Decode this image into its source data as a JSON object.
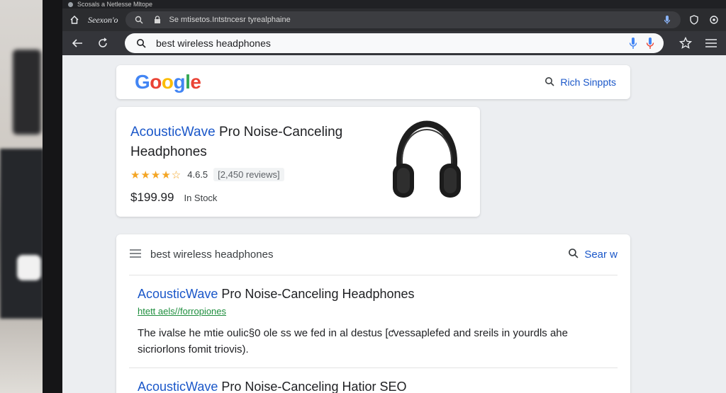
{
  "titlebar": {
    "text": "Scosals a Netlesse Mltope"
  },
  "tabbar": {
    "tab_title": "Seexon'o",
    "url": "Se mtisetos.Intstncesr tyrealphaine"
  },
  "toolbar": {
    "search_query": "best wireless headphones"
  },
  "google": {
    "logo_letters": [
      "G",
      "o",
      "o",
      "g",
      "l",
      "e"
    ],
    "logo_colors": [
      "#4285f4",
      "#ea4335",
      "#fbbc05",
      "#4285f4",
      "#34a853",
      "#ea4335"
    ],
    "rich_snippets_label": "Rich Sinppts"
  },
  "product": {
    "brand": "AcousticWave",
    "title_rest": " Pro Noise-Canceling Headphones",
    "stars": "★★★★☆",
    "rating": "4.6.5",
    "reviews": "[2,450 reviews]",
    "price": "$199.99",
    "stock": "In Stock"
  },
  "results": {
    "header_label": "best wireless headphones",
    "search_label": "Sear w",
    "items": [
      {
        "brand": "AcousticWave",
        "title_rest": " Pro Noise-Canceling Headphones",
        "url": "htett aels//forropiones",
        "snippet": "The ivalse he mtie oulic§0 ole ss we fed in al destus [ƈvessaplefed and sreils in yourdls ahe sicriorlons fomit triovis)."
      },
      {
        "brand": "AcousticWave",
        "title_rest": " Pro Noise-Canceling Hatior SEO"
      }
    ]
  },
  "colors": {
    "accent_blue": "#1a57c9",
    "url_green": "#1e8e3e",
    "star_gold": "#f4a524"
  }
}
